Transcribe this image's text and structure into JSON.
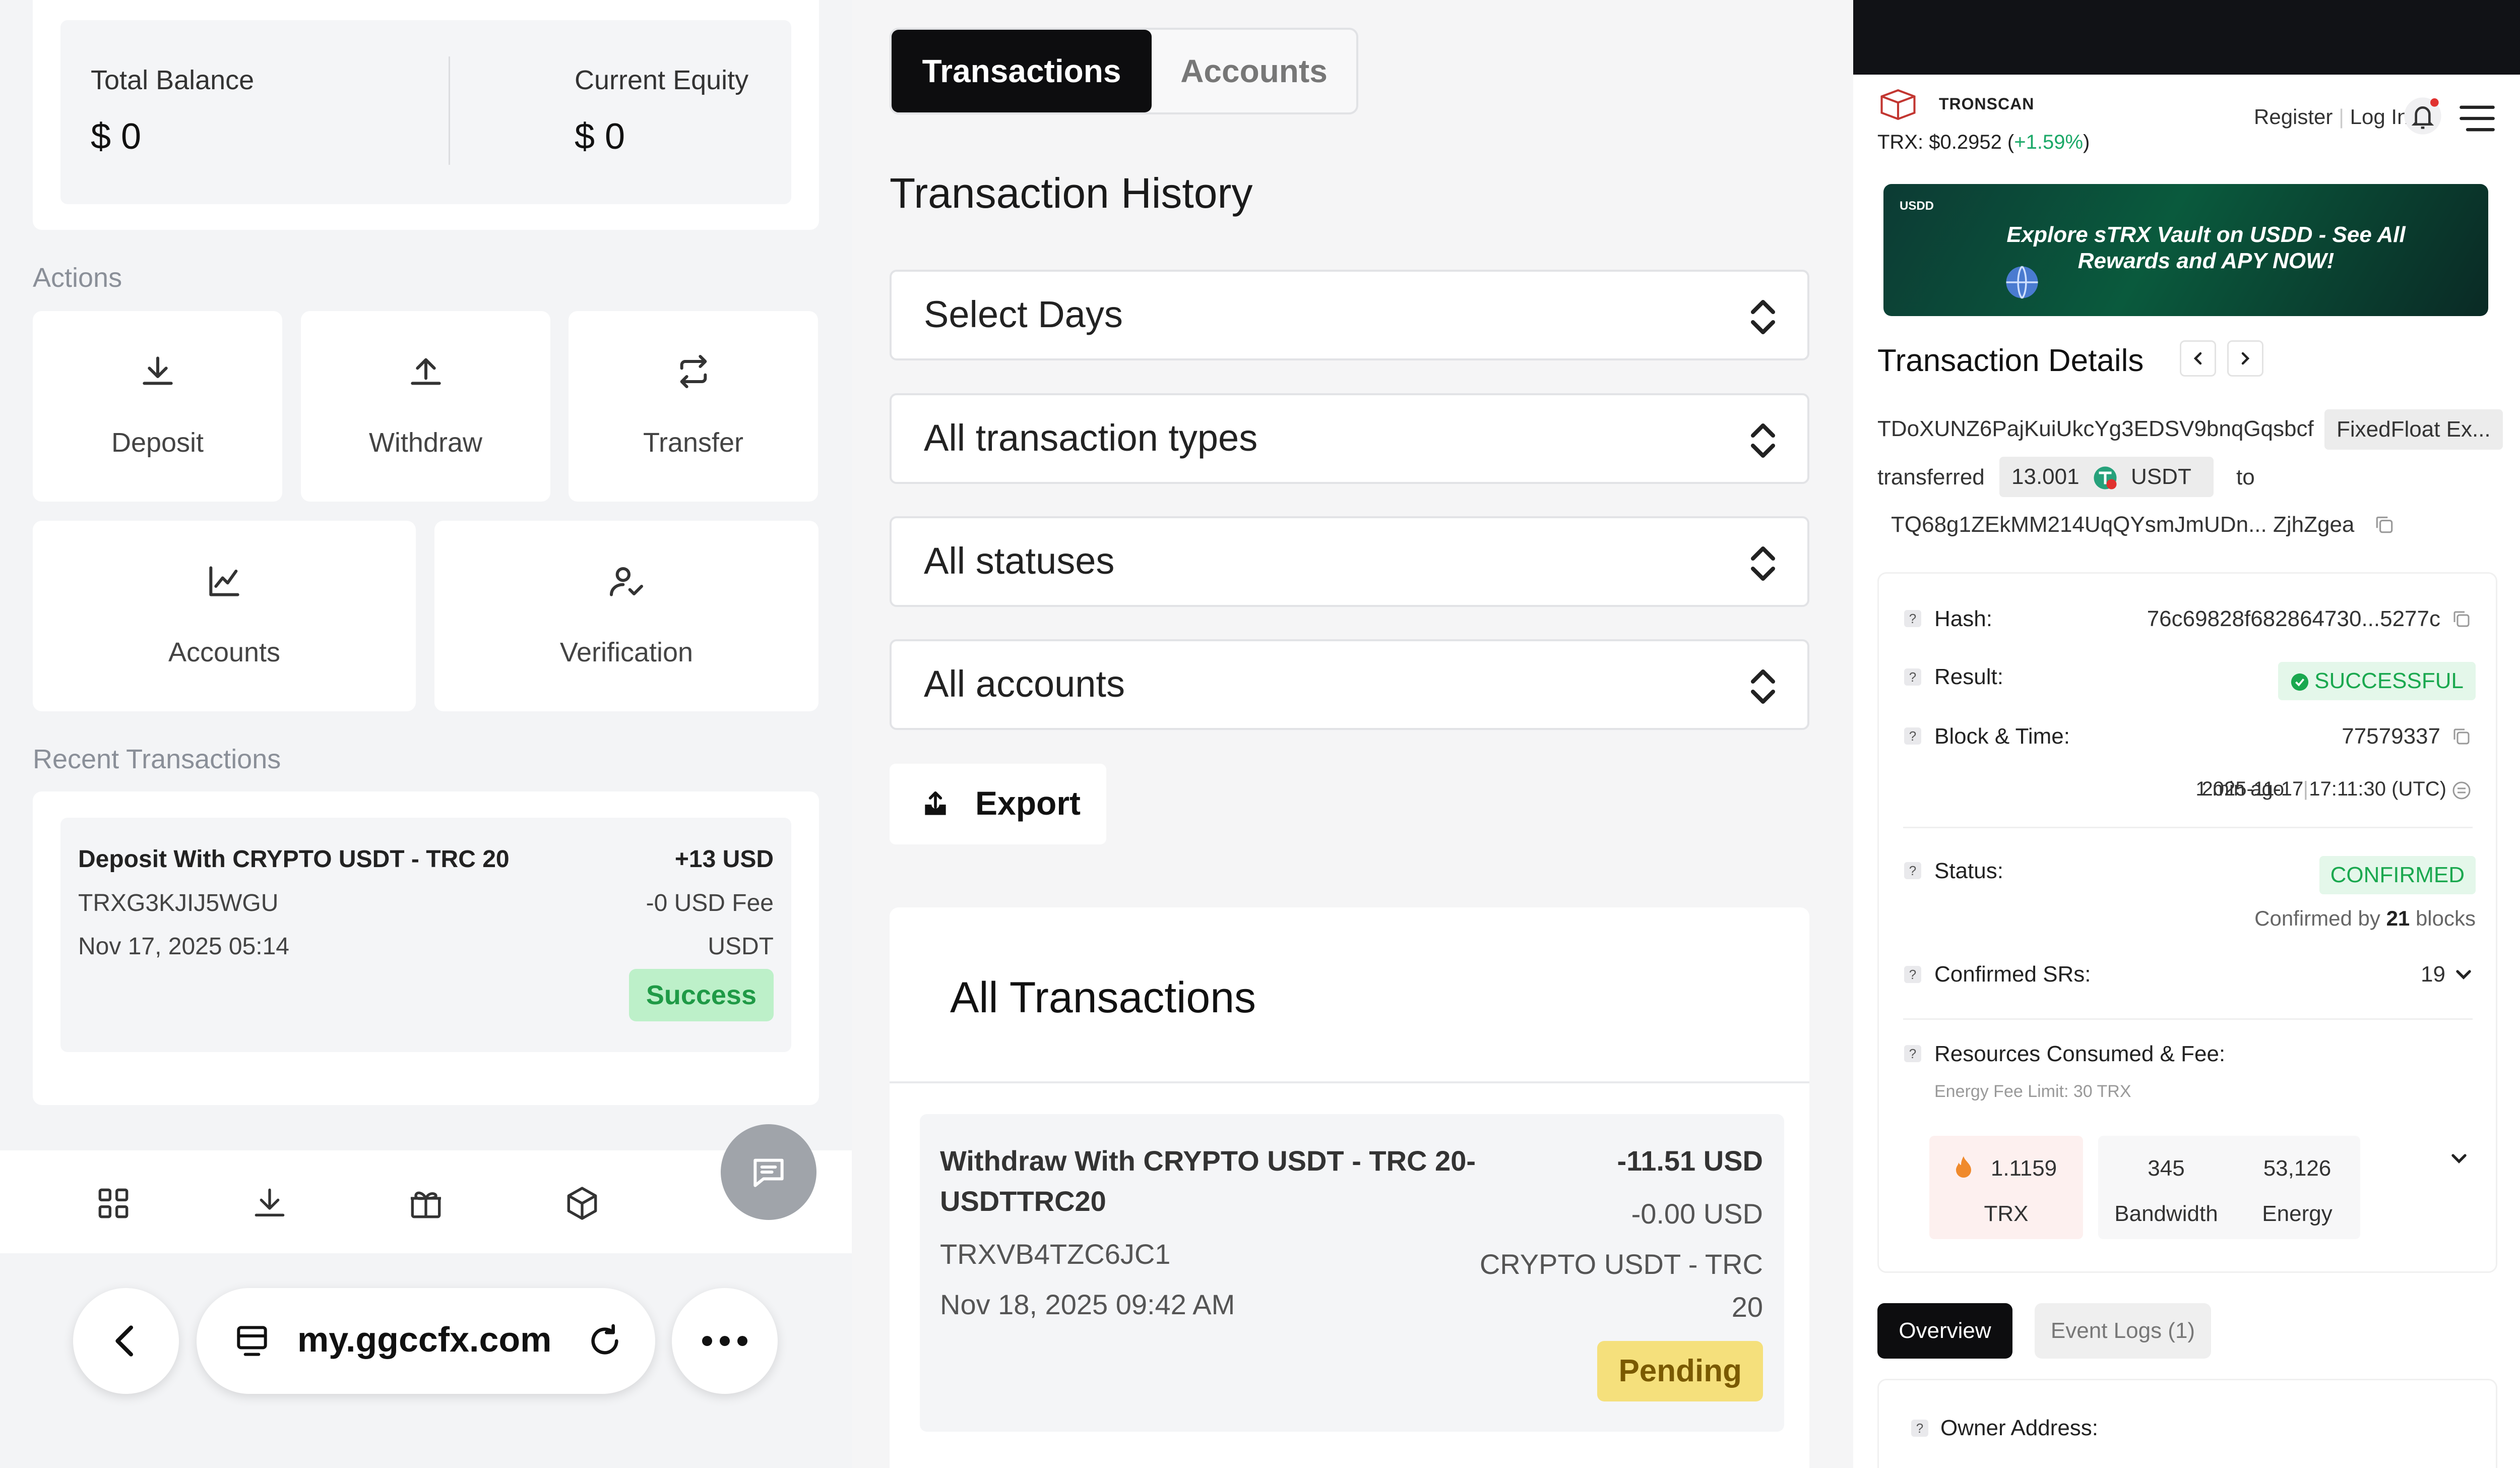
{
  "left": {
    "balance": {
      "total_label": "Total Balance",
      "total_value": "$ 0",
      "equity_label": "Current Equity",
      "equity_value": "$ 0"
    },
    "actions_label": "Actions",
    "actions": {
      "deposit": "Deposit",
      "withdraw": "Withdraw",
      "transfer": "Transfer",
      "accounts": "Accounts",
      "verification": "Verification"
    },
    "recent_label": "Recent Transactions",
    "recent_tx": {
      "title": "Deposit With CRYPTO USDT - TRC 20",
      "amount": "+13 USD",
      "id": "TRXG3KJIJ5WGU",
      "fee": "-0 USD Fee",
      "date": "Nov 17, 2025 05:14",
      "currency": "USDT",
      "status": "Success"
    },
    "browser": {
      "url": "my.ggccfx.com"
    }
  },
  "mid": {
    "tabs": {
      "transactions": "Transactions",
      "accounts": "Accounts"
    },
    "history_title": "Transaction History",
    "filters": {
      "days": "Select Days",
      "types": "All transaction types",
      "statuses": "All statuses",
      "accounts": "All accounts"
    },
    "export_label": "Export",
    "all_tx_title": "All Transactions",
    "tx": {
      "title_line1": "Withdraw With CRYPTO USDT - TRC 20-",
      "title_line2": "USDTTRC20",
      "amount": "-11.51 USD",
      "fee": "-0.00 USD",
      "id": "TRXVB4TZC6JC1",
      "method_line1": "CRYPTO USDT - TRC",
      "method_line2": "20",
      "date": "Nov 18, 2025 09:42 AM",
      "status": "Pending"
    }
  },
  "right": {
    "brand": "TRONSCAN",
    "price_label": "TRX: $0.2952 (",
    "price_change": "+1.59%",
    "price_close": ")",
    "register": "Register",
    "login": "Log In",
    "banner": {
      "tag": "USDD",
      "text": "Explore sTRX Vault on USDD - See All Rewards and APY NOW!"
    },
    "title": "Transaction Details",
    "from_address": "TDoXUNZ6PajKuiUkcYg3EDSV9bnqGqsbcf",
    "from_tag": "FixedFloat Ex...",
    "transferred_label": "transferred",
    "amount": "13.001",
    "token": "USDT",
    "to_label": "to",
    "to_address": "TQ68g1ZEkMM214UqQYsmJmUDn... ZjhZgea",
    "hash_label": "Hash:",
    "hash_value": "76c69828f682864730...5277c",
    "result_label": "Result:",
    "result_value": "SUCCESSFUL",
    "block_label": "Block & Time:",
    "block_value": "77579337",
    "time_ago": "1 min ago",
    "time_sep": "|",
    "time_value": "2025-11-17 17:11:30 (UTC)",
    "status_label": "Status:",
    "status_value": "CONFIRMED",
    "confirmed_by_prefix": "Confirmed by ",
    "confirmed_by_count": "21",
    "confirmed_by_suffix": " blocks",
    "srs_label": "Confirmed SRs:",
    "srs_value": "19",
    "resources_label": "Resources Consumed & Fee:",
    "energy_limit": "Energy Fee Limit: 30 TRX",
    "res": {
      "trx_value": "1.1159",
      "trx_unit": "TRX",
      "bw_value": "345",
      "bw_unit": "Bandwidth",
      "en_value": "53,126",
      "en_unit": "Energy"
    },
    "tab_overview": "Overview",
    "tab_events": "Event Logs (1)",
    "owner_label": "Owner Address:"
  }
}
